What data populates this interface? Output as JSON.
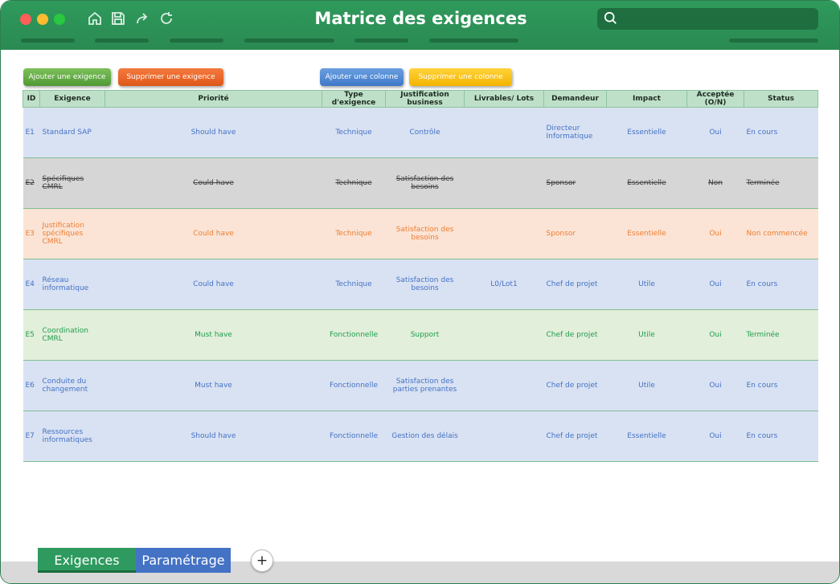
{
  "window": {
    "title": "Matrice des exigences",
    "colors": {
      "titlebar": "#2a8a52",
      "accent_dark": "#1f6e40"
    }
  },
  "toolbar": {
    "icons": [
      "home-icon",
      "save-icon",
      "redo-icon",
      "refresh-icon"
    ],
    "search_icon": "search-icon"
  },
  "actions": {
    "add_requirement": "Ajouter une exigence",
    "delete_requirement": "Supprimer une exigence",
    "add_column": "Ajouter une colonne",
    "delete_column": "Supprimer une colonne"
  },
  "table": {
    "headers": [
      "ID",
      "Exigence",
      "Priorité",
      "Type d'exigence",
      "Justification business",
      "Livrables/ Lots",
      "Demandeur",
      "Impact",
      "Acceptée (O/N)",
      "Status"
    ],
    "rows": [
      {
        "style": "blue",
        "cells": [
          "E1",
          "Standard SAP",
          "Should have",
          "Technique",
          "Contrôle",
          "",
          "Directeur Informatique",
          "Essentielle",
          "Oui",
          "En cours"
        ]
      },
      {
        "style": "gray",
        "cells": [
          "E2",
          "Spécifiques CMRL",
          "Could have",
          "Technique",
          "Satisfaction des besoins",
          "",
          "Sponsor",
          "Essentielle",
          "Non",
          "Terminée"
        ]
      },
      {
        "style": "orange",
        "cells": [
          "E3",
          "Justification spécifiques CMRL",
          "Could have",
          "Technique",
          "Satisfaction des besoins",
          "",
          "Sponsor",
          "Essentielle",
          "Oui",
          "Non commencée"
        ]
      },
      {
        "style": "blue",
        "cells": [
          "E4",
          "Réseau informatique",
          "Could have",
          "Technique",
          "Satisfaction des besoins",
          "L0/Lot1",
          "Chef de projet",
          "Utile",
          "Oui",
          "En cours"
        ]
      },
      {
        "style": "green",
        "cells": [
          "E5",
          "Coordination CMRL",
          "Must have",
          "Fonctionnelle",
          "Support",
          "",
          "Chef de projet",
          "Utile",
          "Oui",
          "Terminée"
        ]
      },
      {
        "style": "blue",
        "cells": [
          "E6",
          "Conduite du changement",
          "Must have",
          "Fonctionnelle",
          "Satisfaction des parties prenantes",
          "",
          "Chef de projet",
          "Utile",
          "Oui",
          "En cours"
        ]
      },
      {
        "style": "blue",
        "cells": [
          "E7",
          "Ressources informatiques",
          "Should have",
          "Fonctionnelle",
          "Gestion des délais",
          "",
          "Chef de projet",
          "Essentielle",
          "Oui",
          "En cours"
        ]
      }
    ],
    "row_colors": {
      "blue": "#d9e2f3",
      "gray": "#d6d6d6",
      "orange": "#fbe4d5",
      "green": "#e2efda"
    }
  },
  "sheets": {
    "tabs": [
      "Exigences",
      "Paramétrage"
    ],
    "active": "Exigences",
    "add_label": "+"
  }
}
